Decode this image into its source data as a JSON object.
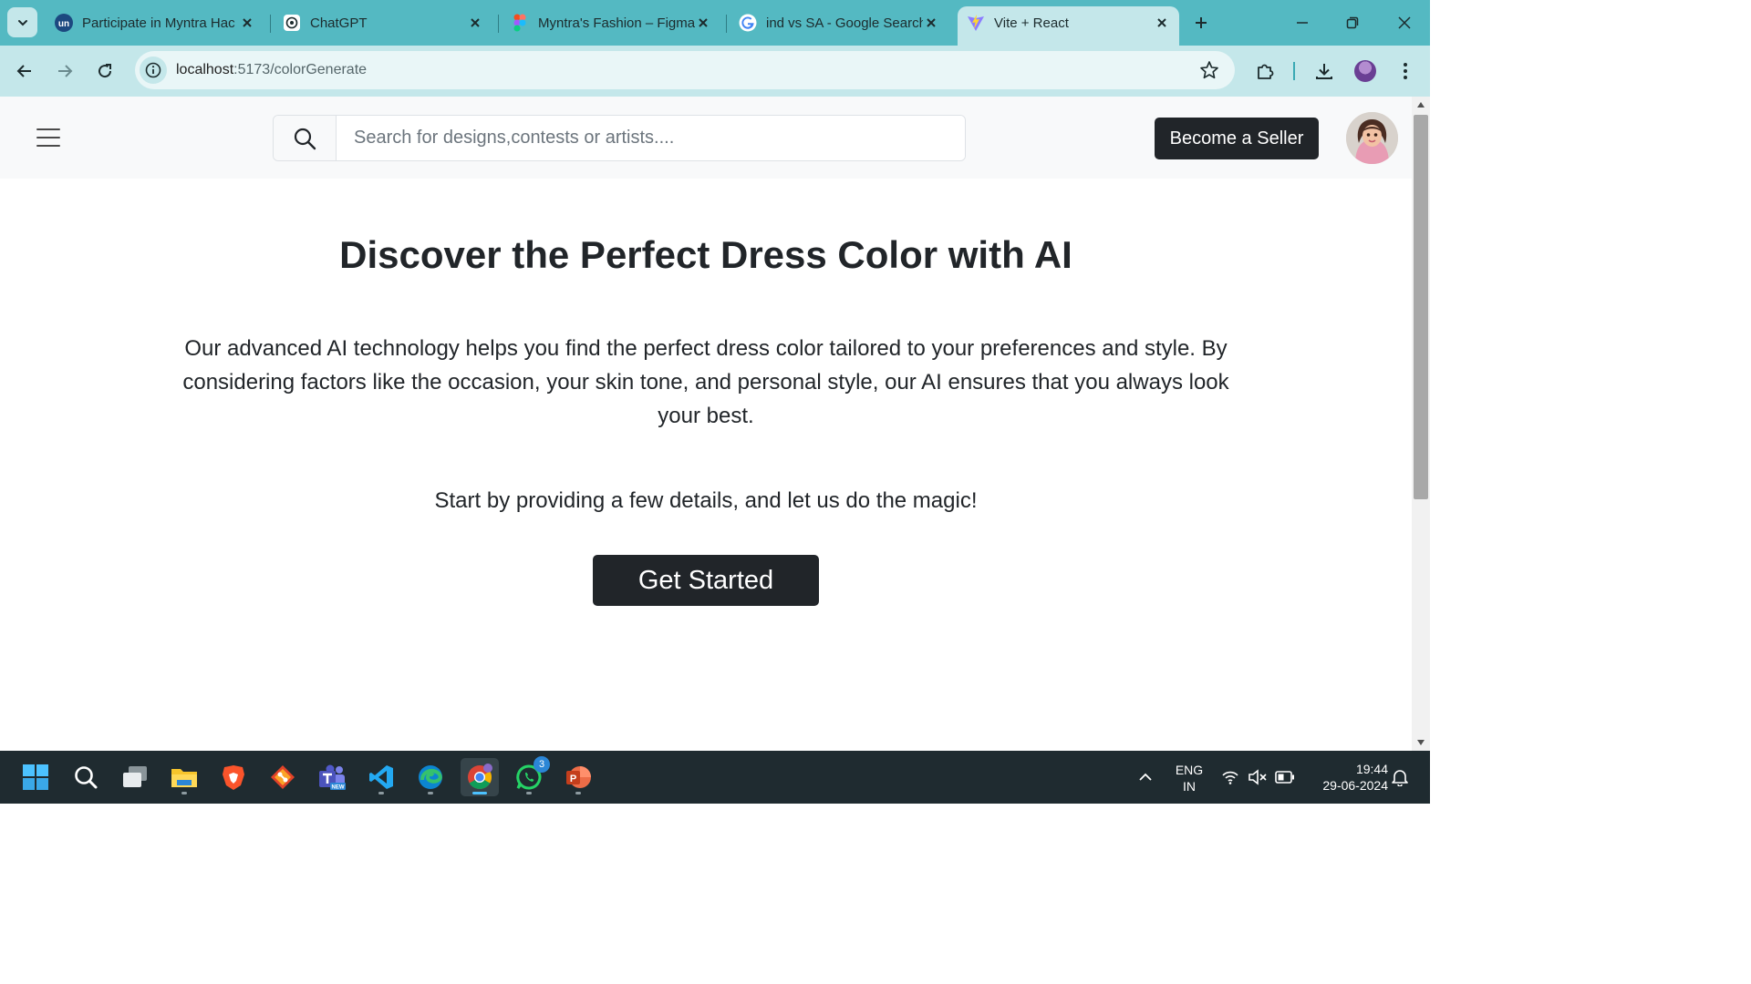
{
  "browser": {
    "tabs": [
      {
        "title": "Participate in Myntra Hac",
        "favicon": "unstop-icon",
        "active": false
      },
      {
        "title": "ChatGPT",
        "favicon": "chatgpt-icon",
        "active": false
      },
      {
        "title": "Myntra's Fashion – Figma",
        "favicon": "figma-icon",
        "active": false
      },
      {
        "title": "ind vs SA - Google Search",
        "favicon": "google-icon",
        "active": false
      },
      {
        "title": "Vite + React",
        "favicon": "vite-icon",
        "active": true
      }
    ],
    "url": {
      "host": "localhost",
      "rest": ":5173/colorGenerate"
    }
  },
  "header": {
    "search_placeholder": "Search for designs,contests or artists....",
    "seller_button": "Become a Seller"
  },
  "hero": {
    "title": "Discover the Perfect Dress Color with AI",
    "description": "Our advanced AI technology helps you find the perfect dress color tailored to your preferences and style. By considering factors like the occasion, your skin tone, and personal style, our AI ensures that you always look your best.",
    "cta_text": "Start by providing a few details, and let us do the magic!",
    "cta_button": "Get Started"
  },
  "taskbar": {
    "apps": [
      "start-icon",
      "search-icon",
      "task-view-icon",
      "file-explorer-icon",
      "brave-icon",
      "git-icon",
      "teams-icon",
      "vscode-icon",
      "edge-icon",
      "chrome-icon",
      "whatsapp-icon",
      "powerpoint-icon"
    ],
    "whatsapp_badge": "3",
    "language": {
      "line1": "ENG",
      "line2": "IN"
    },
    "time": "19:44",
    "date": "29-06-2024"
  },
  "colors": {
    "tabstrip": "#54b9c2",
    "toolbar": "#c4e7ea",
    "dark_button": "#212529",
    "taskbar": "#1f2b30"
  }
}
